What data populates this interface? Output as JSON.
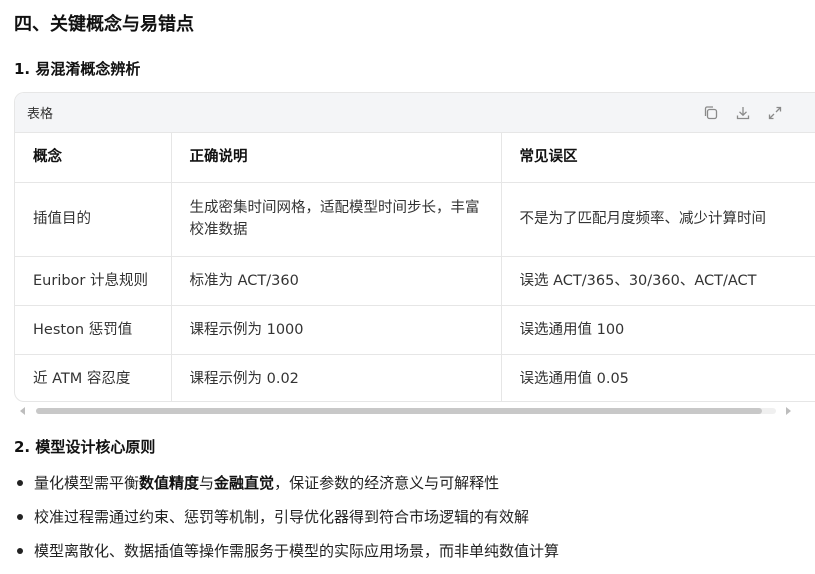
{
  "section_title": "四、关键概念与易错点",
  "subsection1_title": "1. 易混淆概念辨析",
  "table": {
    "card_label": "表格",
    "icons": [
      "copy-icon",
      "download-icon",
      "expand-icon"
    ],
    "headers": [
      "概念",
      "正确说明",
      "常见误区"
    ],
    "rows": [
      [
        "插值目的",
        "生成密集时间网格，适配模型时间步长，丰富校准数据",
        "不是为了匹配月度频率、减少计算时间"
      ],
      [
        "Euribor 计息规则",
        "标准为 ACT/360",
        "误选 ACT/365、30/360、ACT/ACT"
      ],
      [
        "Heston 惩罚值",
        "课程示例为 1000",
        "误选通用值 100"
      ],
      [
        "近 ATM 容忍度",
        "课程示例为 0.02",
        "误选通用值 0.05"
      ]
    ]
  },
  "subsection2_title": "2. 模型设计核心原则",
  "bullets": [
    {
      "pre": "量化模型需平衡",
      "b1": "数值精度",
      "mid": "与",
      "b2": "金融直觉",
      "post": "，保证参数的经济意义与可解释性"
    },
    {
      "text": "校准过程需通过约束、惩罚等机制，引导优化器得到符合市场逻辑的有效解"
    },
    {
      "text": "模型离散化、数据插值等操作需服务于模型的实际应用场景，而非单纯数值计算"
    }
  ]
}
